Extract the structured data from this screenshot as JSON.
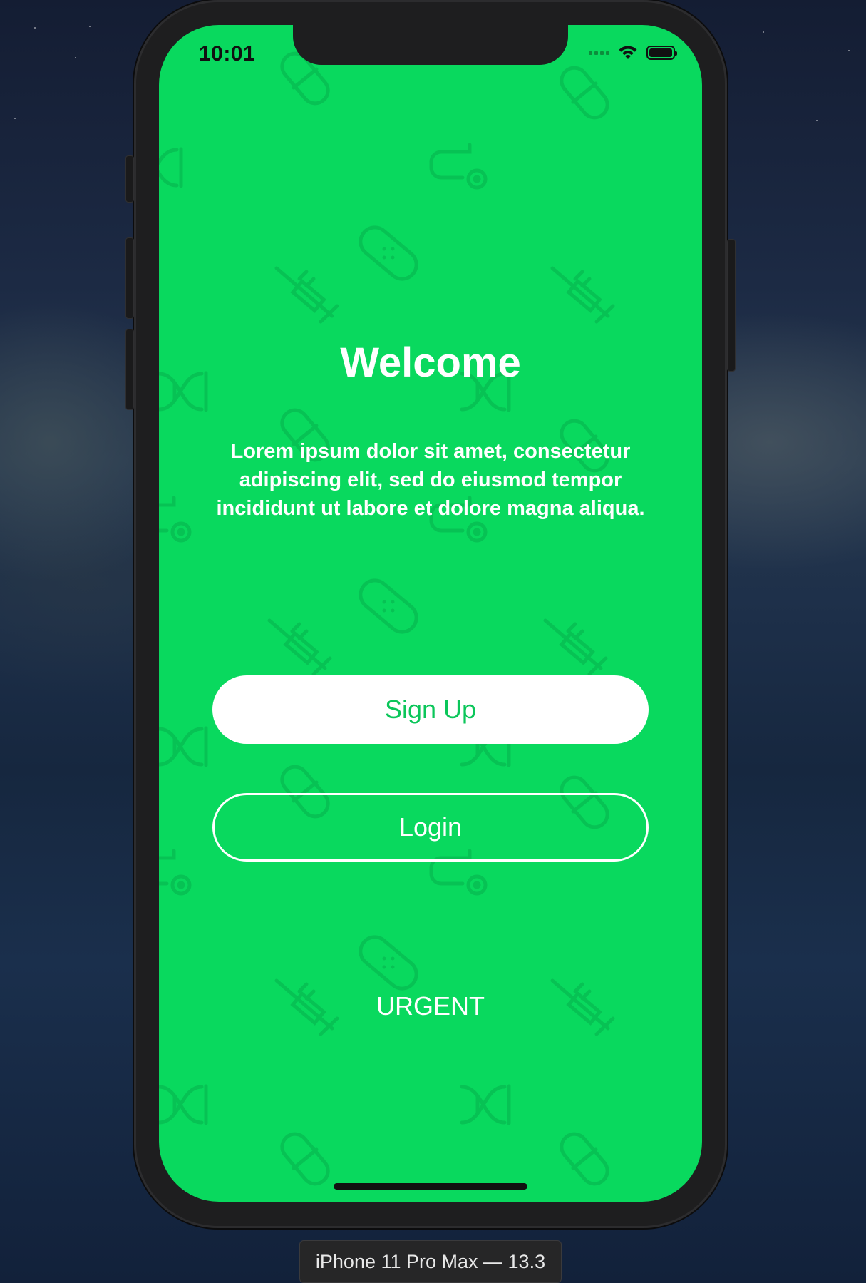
{
  "status_bar": {
    "time": "10:01",
    "icons": [
      "cellular-signal-icon",
      "wifi-icon",
      "battery-icon"
    ]
  },
  "screen": {
    "title": "Welcome",
    "description": "Lorem ipsum dolor sit amet, consectetur adipiscing elit, sed do eiusmod tempor incididunt ut labore et dolore magna aliqua.",
    "signup_label": "Sign Up",
    "login_label": "Login",
    "urgent_label": "URGENT",
    "background_icons": [
      "pill-icon",
      "stethoscope-icon",
      "bandage-icon",
      "syringe-icon",
      "dna-icon"
    ]
  },
  "simulator": {
    "device_label": "iPhone 11 Pro Max — 13.3"
  },
  "colors": {
    "brand_green": "#09d95e",
    "button_text_green": "#0bc65a",
    "white": "#ffffff"
  }
}
